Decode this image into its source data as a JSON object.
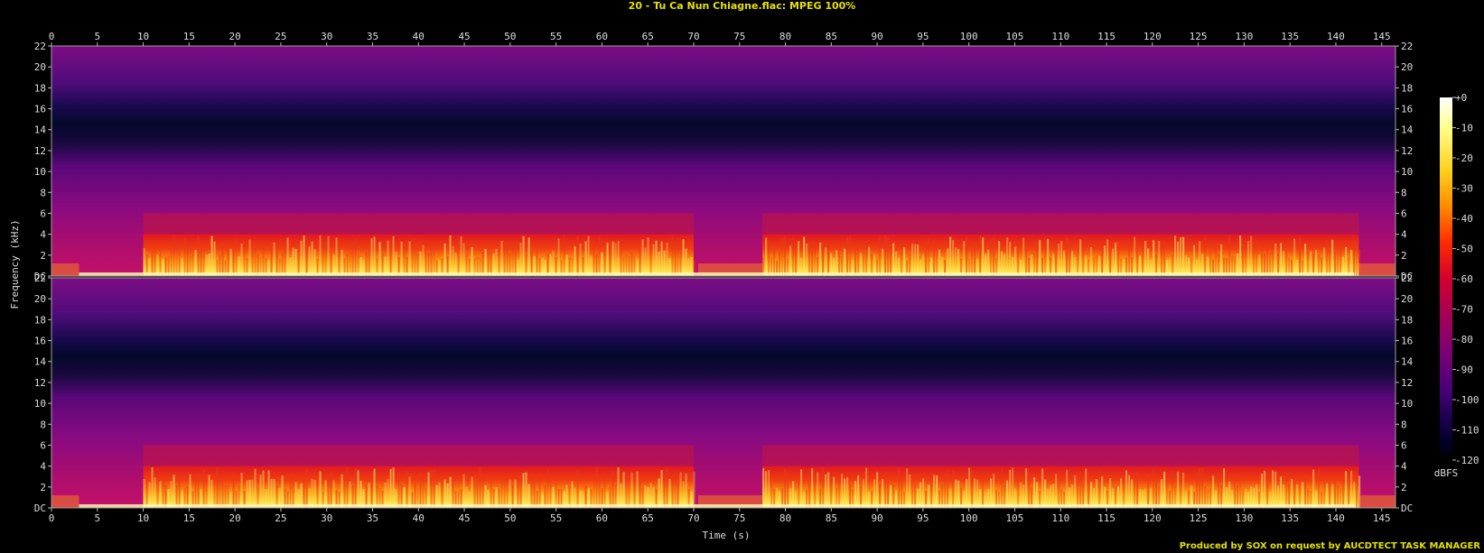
{
  "title": "20 - Tu Ca Nun Chiagne.flac: MPEG 100%",
  "footer": "Produced by SOX on request by AUCDTECT TASK MANAGER",
  "chart_data": {
    "type": "heatmap",
    "title": "20 - Tu Ca Nun Chiagne.flac: MPEG 100%",
    "xlabel": "Time (s)",
    "ylabel": "Frequency (kHz)",
    "xlim": [
      0,
      146.5
    ],
    "ylim": [
      0,
      22
    ],
    "x_ticks": [
      0,
      5,
      10,
      15,
      20,
      25,
      30,
      35,
      40,
      45,
      50,
      55,
      60,
      65,
      70,
      75,
      80,
      85,
      90,
      95,
      100,
      105,
      110,
      115,
      120,
      125,
      130,
      135,
      140,
      145
    ],
    "y_tick_labels": [
      "DC",
      "2",
      "4",
      "6",
      "8",
      "10",
      "12",
      "14",
      "16",
      "18",
      "20",
      "22"
    ],
    "y_tick_values": [
      0,
      2,
      4,
      6,
      8,
      10,
      12,
      14,
      16,
      18,
      20,
      22
    ],
    "channels": [
      "channel 1",
      "channel 2"
    ],
    "colorbar": {
      "label": "dBFS",
      "ticks": [
        "+0",
        "-10",
        "-20",
        "-30",
        "-40",
        "-50",
        "-60",
        "-70",
        "-80",
        "-90",
        "-100",
        "-110",
        "-120"
      ],
      "colors": [
        "#ffffff",
        "#ffff80",
        "#ffd21e",
        "#ff8c00",
        "#ff2a00",
        "#d2002d",
        "#a50055",
        "#7d0073",
        "#4b0078",
        "#1e0050",
        "#000028",
        "#000000"
      ]
    },
    "quiet_segments_s": [
      [
        0,
        3
      ],
      [
        70.5,
        77.5
      ],
      [
        142.5,
        146.5
      ]
    ],
    "loud_segments_s": [
      [
        10,
        70
      ],
      [
        77.5,
        142.5
      ]
    ],
    "dense_energy_band_khz": [
      0,
      4
    ],
    "sparse_energy_up_to_khz": 6,
    "spectral_cutoff_khz": 15.5
  }
}
